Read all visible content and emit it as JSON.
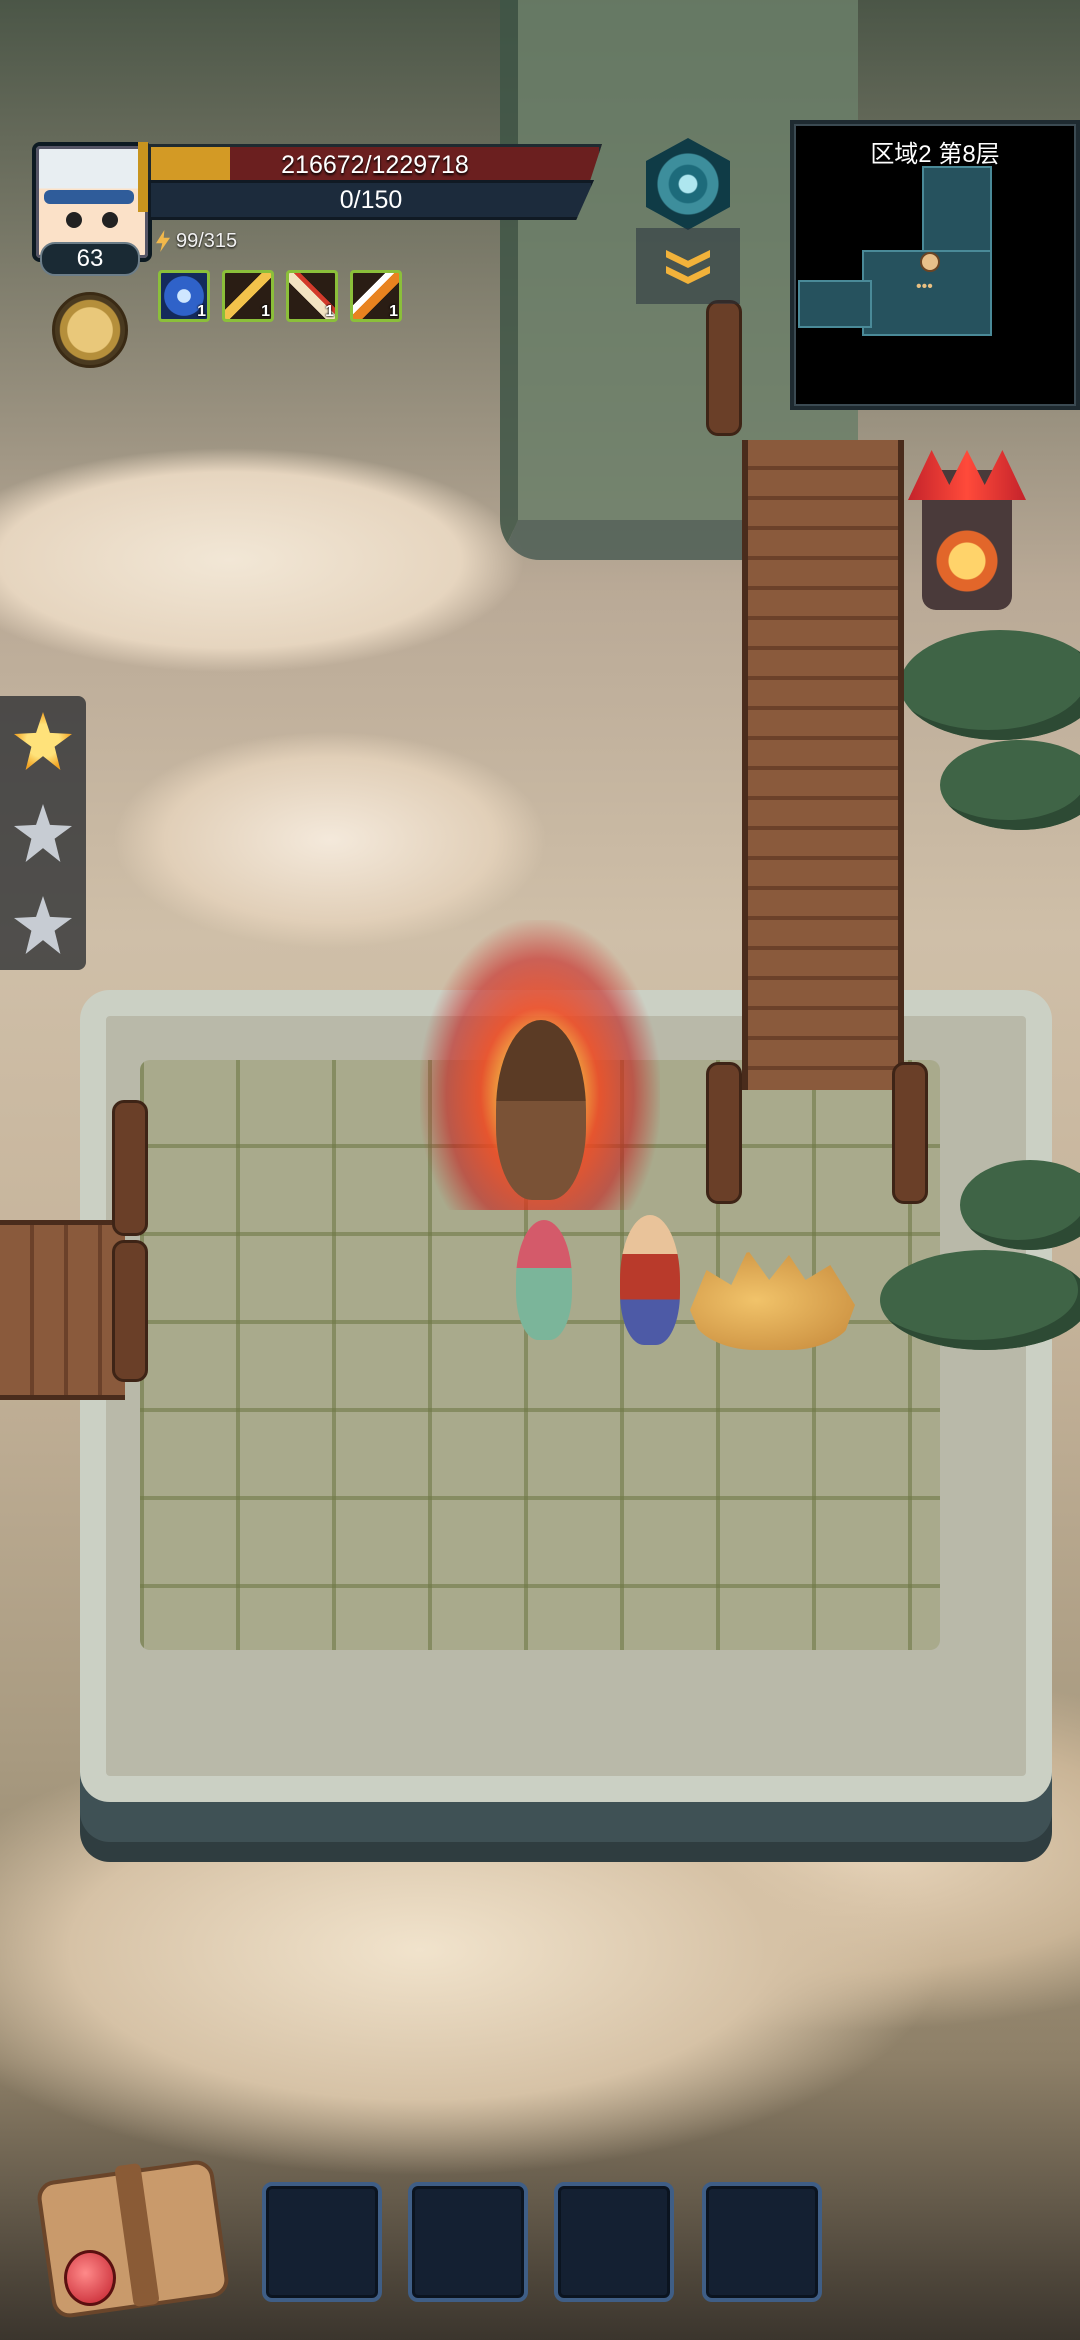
{
  "player": {
    "level": "63",
    "hp_text": "216672/1229718",
    "hp_fraction": 0.176,
    "mp_text": "0/150",
    "mp_fraction": 0,
    "energy_text": "99/315"
  },
  "skills": [
    {
      "icon": "frost-wheel-icon",
      "level": "1"
    },
    {
      "icon": "rank-up-icon",
      "level": "1"
    },
    {
      "icon": "crossed-blades-icon",
      "level": "1"
    },
    {
      "icon": "slash-burst-icon",
      "level": "1"
    }
  ],
  "minimap": {
    "title": "区域2 第8层"
  },
  "stars": {
    "earned": 1,
    "total": 3
  },
  "inventory_slots": 4,
  "colors": {
    "hp_bar": "#6b1f1f",
    "hp_fill": "#d39a25",
    "mp_bar": "#1c2b3c",
    "skill_border": "#8bbf3a",
    "star_on": "#f2a424",
    "slot_border": "#3f5e86"
  }
}
